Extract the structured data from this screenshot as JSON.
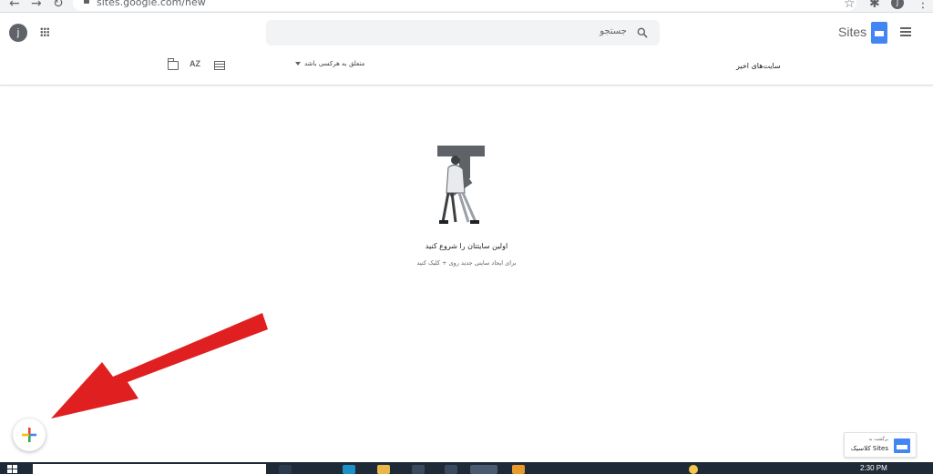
{
  "browser": {
    "url": "sites.google.com/new",
    "profile_initial": "j"
  },
  "header": {
    "avatar_initial": "j",
    "search_placeholder": "جستجو",
    "product_name": "Sites"
  },
  "toolbar": {
    "recent_title": "سایت‌های اخیر",
    "owner_filter": "متعلق به هرکسی باشد",
    "sort_icon_text": "AZ"
  },
  "empty_state": {
    "title": "اولین سایتتان را شروع کنید",
    "subtitle": "برای ایجاد سایتی جدید روی + کلیک کنید"
  },
  "classic_card": {
    "line1": "برگشت به",
    "line2": "Sites کلاسیک"
  },
  "taskbar": {
    "time": "2:30 PM"
  },
  "colors": {
    "fab_plus": [
      "#ea4335",
      "#fbbc04",
      "#34a853",
      "#4285f4"
    ],
    "annotation_arrow": "#e02020",
    "sites_brand": "#4285f4"
  }
}
